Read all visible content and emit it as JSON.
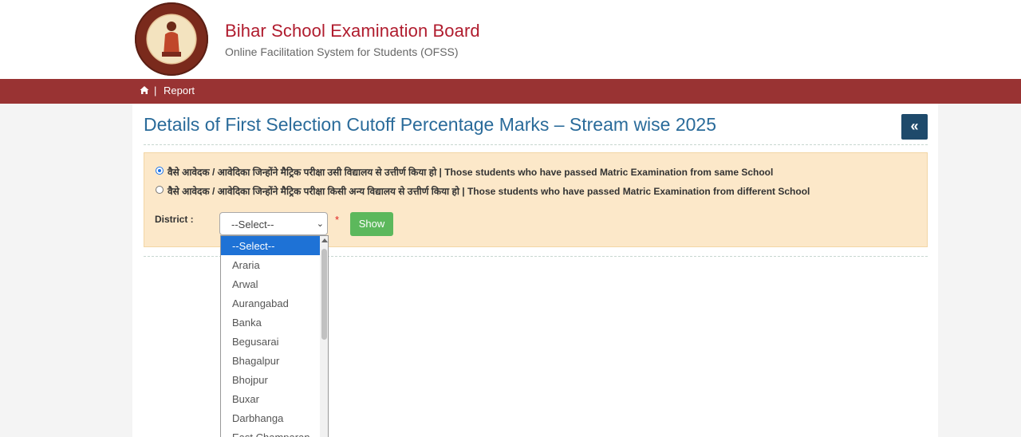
{
  "header": {
    "title": "Bihar School Examination Board",
    "subtitle": "Online Facilitation System for Students (OFSS)"
  },
  "nav": {
    "home_icon": "home-icon",
    "separator": "|",
    "report": "Report"
  },
  "page": {
    "title": "Details of First Selection Cutoff Percentage Marks – Stream wise 2025",
    "back_icon": "«"
  },
  "form": {
    "options": [
      {
        "label": "वैसे आवेदक / आवेदिका जिन्होंने मैट्रिक परीक्षा उसी विद्यालय से उत्तीर्ण किया हो | Those students who have passed Matric Examination from same School",
        "checked": true
      },
      {
        "label": "वैसे आवेदक / आवेदिका जिन्होंने मैट्रिक परीक्षा किसी अन्य विद्यालय से उत्तीर्ण किया हो | Those students who have passed Matric Examination from different School",
        "checked": false
      }
    ],
    "district_label": "District :",
    "select_value": "--Select--",
    "required_mark": "*",
    "show_button": "Show"
  },
  "dropdown": {
    "items": [
      "--Select--",
      "Araria",
      "Arwal",
      "Aurangabad",
      "Banka",
      "Begusarai",
      "Bhagalpur",
      "Bhojpur",
      "Buxar",
      "Darbhanga",
      "East Champaran"
    ],
    "selected_index": 0
  }
}
